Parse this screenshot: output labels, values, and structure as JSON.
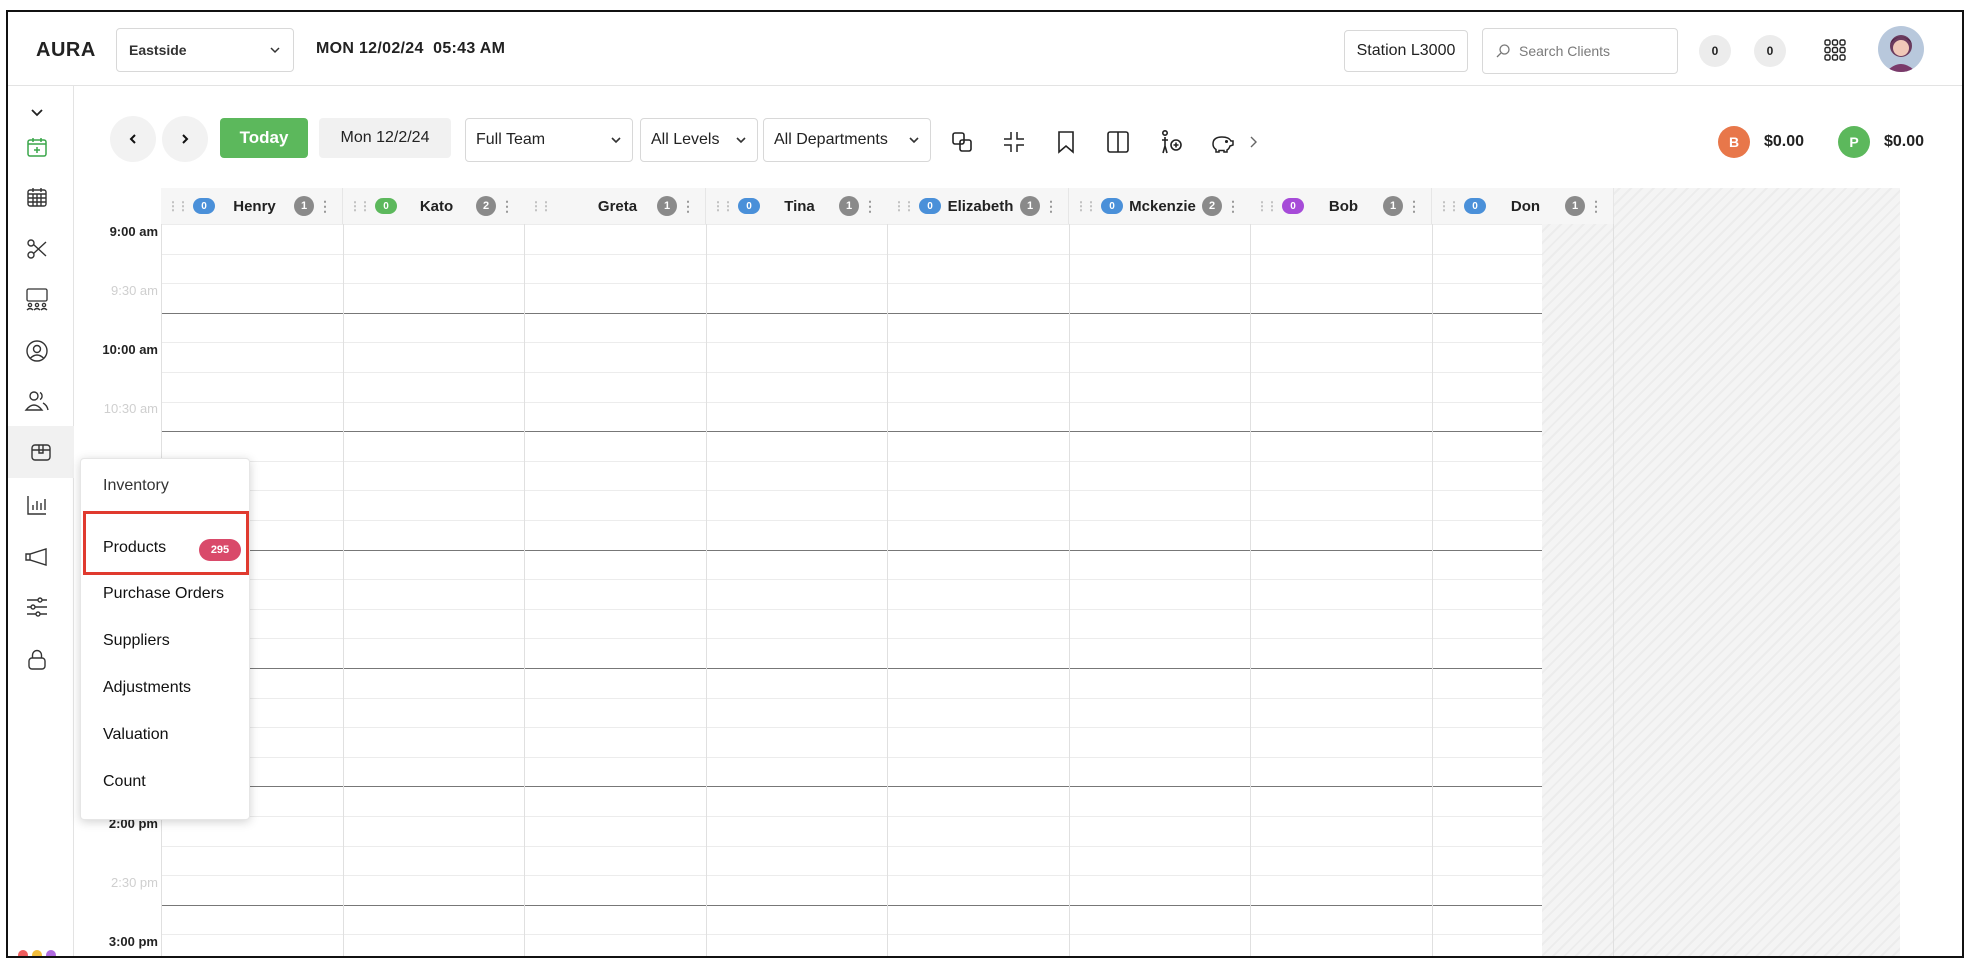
{
  "app": {
    "brand": "AURA",
    "datetime": "MON 12/02/24  05:43 AM"
  },
  "location_select": {
    "value": "Eastside"
  },
  "station": {
    "label": "Station L3000"
  },
  "search": {
    "placeholder": "Search Clients"
  },
  "counters": [
    "0",
    "0"
  ],
  "toolbar": {
    "today_label": "Today",
    "date_label": "Mon 12/2/24",
    "team_filter": "Full Team",
    "level_filter": "All Levels",
    "department_filter": "All Departments"
  },
  "balances": [
    {
      "letter": "B",
      "amount": "$0.00",
      "color": "#e8774a"
    },
    {
      "letter": "P",
      "amount": "$0.00",
      "color": "#5cb85c"
    }
  ],
  "staff": [
    {
      "name": "Henry",
      "pill": "0",
      "pill_color": "#4a90d9",
      "count": "1"
    },
    {
      "name": "Kato",
      "pill": "0",
      "pill_color": "#5cb85c",
      "count": "2"
    },
    {
      "name": "Greta",
      "pill": "",
      "pill_color": "",
      "count": "1"
    },
    {
      "name": "Tina",
      "pill": "0",
      "pill_color": "#4a90d9",
      "count": "1"
    },
    {
      "name": "Elizabeth",
      "pill": "0",
      "pill_color": "#4a90d9",
      "count": "1"
    },
    {
      "name": "Mckenzie",
      "pill": "0",
      "pill_color": "#4a90d9",
      "count": "2"
    },
    {
      "name": "Bob",
      "pill": "0",
      "pill_color": "#a64bd8",
      "count": "1"
    },
    {
      "name": "Don",
      "pill": "0",
      "pill_color": "#4a90d9",
      "count": "1"
    }
  ],
  "times": [
    "9:00 am",
    "9:30 am",
    "10:00 am",
    "10:30 am",
    "2:00 pm",
    "2:30 pm",
    "3:00 pm"
  ],
  "inventory_menu": {
    "title": "Inventory",
    "products_label": "Products",
    "products_count": "295",
    "items": [
      "Purchase Orders",
      "Suppliers",
      "Adjustments",
      "Valuation",
      "Count"
    ]
  },
  "colors": {
    "accent_green": "#5cb85c",
    "highlight_red": "#e03a2f",
    "badge_pink": "#d94a6a"
  }
}
